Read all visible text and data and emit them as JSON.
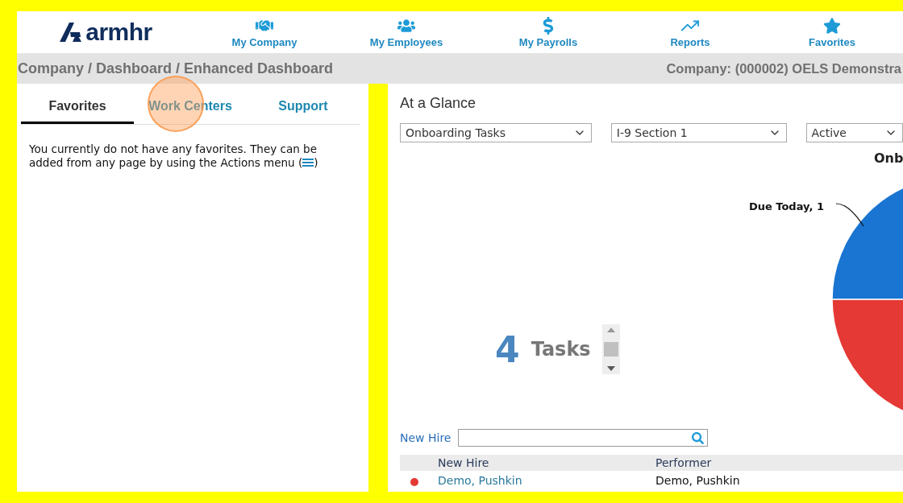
{
  "logo": {
    "text": "armhr"
  },
  "nav": [
    {
      "label": "My Company"
    },
    {
      "label": "My Employees"
    },
    {
      "label": "My Payrolls"
    },
    {
      "label": "Reports"
    },
    {
      "label": "Favorites"
    }
  ],
  "breadcrumb": "Company / Dashboard / Enhanced Dashboard",
  "company": "Company: (000002) OELS Demonstra",
  "left_tabs": [
    {
      "label": "Favorites",
      "selected": true
    },
    {
      "label": "Work Centers",
      "selected": false
    },
    {
      "label": "Support",
      "selected": false
    }
  ],
  "favorites_message": {
    "text": "You currently do not have any favorites. They can be added from any page by using the Actions menu (",
    "close": ")"
  },
  "panel_title": "At a Glance",
  "dropdowns": [
    {
      "value": "Onboarding Tasks"
    },
    {
      "value": "I-9 Section 1"
    },
    {
      "value": "Active"
    }
  ],
  "chart": {
    "title": "Onb",
    "label": "Due Today, 1",
    "slices": [
      {
        "color": "#1a75d2"
      },
      {
        "color": "#e53935"
      }
    ]
  },
  "counter": {
    "count": "4",
    "unit": "Tasks"
  },
  "filter": {
    "label": "New Hire"
  },
  "table": {
    "columns": [
      "New Hire",
      "Performer"
    ],
    "rows": [
      {
        "color": "#e53935",
        "new_hire": "Demo, Pushkin",
        "performer": "Demo, Pushkin"
      }
    ]
  }
}
